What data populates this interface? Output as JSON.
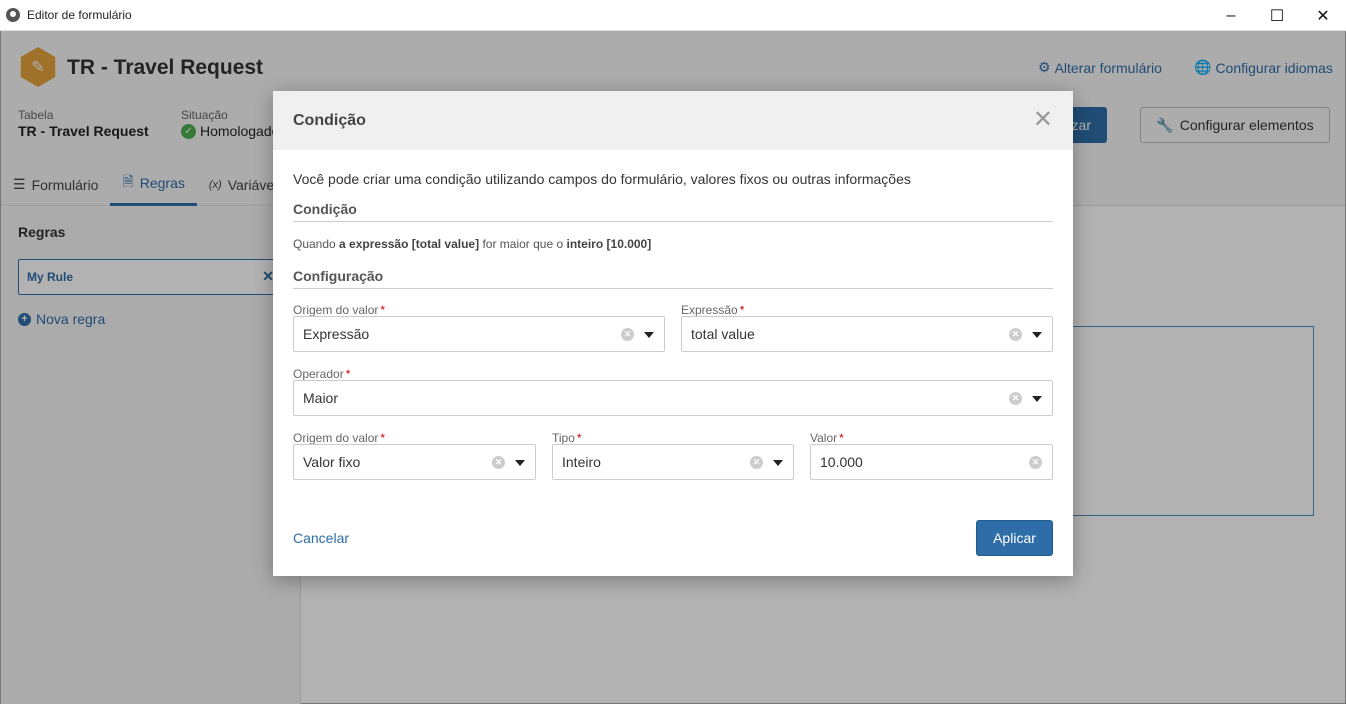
{
  "window": {
    "title": "Editor de formulário"
  },
  "header": {
    "title": "TR - Travel Request",
    "links": {
      "alter_form": "Alterar formulário",
      "config_languages": "Configurar idiomas"
    },
    "table_label": "Tabela",
    "table_value": "TR - Travel Request",
    "status_label": "Situação",
    "status_value": "Homologado",
    "publish_button_partial": "zar",
    "config_elements_button": "Configurar elementos"
  },
  "tabs": [
    {
      "label": "Formulário"
    },
    {
      "label": "Regras"
    },
    {
      "label": "Variáveis"
    }
  ],
  "sidebar": {
    "title": "Regras",
    "rule_item": "My Rule",
    "new_rule": "Nova regra"
  },
  "modal": {
    "title": "Condição",
    "intro": "Você pode criar uma condição utilizando campos do formulário, valores fixos ou outras informações",
    "section_condition": "Condição",
    "summary": {
      "prefix": "Quando",
      "left": "a expressão [total value]",
      "middle": "for maior que o",
      "right": "inteiro [10.000]"
    },
    "section_config": "Configuração",
    "fields": {
      "origin1_label": "Origem do valor",
      "origin1_value": "Expressão",
      "expression_label": "Expressão",
      "expression_value": "total value",
      "operator_label": "Operador",
      "operator_value": "Maior",
      "origin2_label": "Origem do valor",
      "origin2_value": "Valor fixo",
      "type_label": "Tipo",
      "type_value": "Inteiro",
      "value_label": "Valor",
      "value_value": "10.000"
    },
    "cancel": "Cancelar",
    "apply": "Aplicar"
  },
  "colors": {
    "accent": "#2f6da8",
    "logo": "#e6a23c",
    "status_ok": "#4caf50"
  }
}
